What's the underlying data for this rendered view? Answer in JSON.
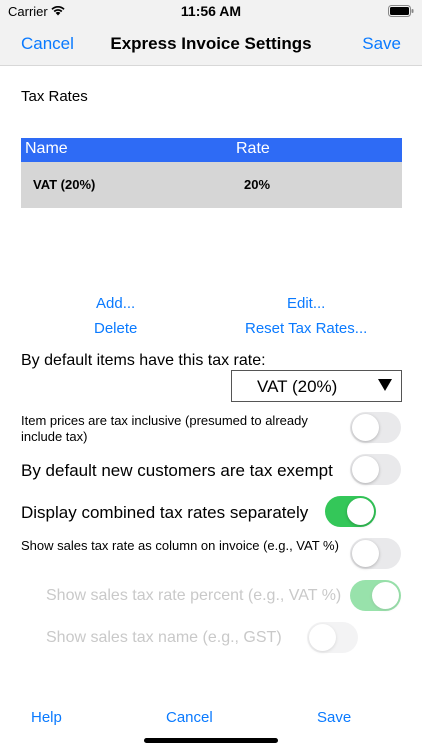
{
  "status_bar": {
    "carrier": "Carrier",
    "time": "11:56 AM",
    "wifi_icon": "wifi-icon",
    "battery_icon": "battery-icon"
  },
  "nav_bar": {
    "cancel_label": "Cancel",
    "title": "Express Invoice Settings",
    "save_label": "Save"
  },
  "tax_rates": {
    "section_title": "Tax Rates",
    "columns": [
      "Name",
      "Rate"
    ],
    "rows": [
      {
        "name": "VAT (20%)",
        "rate": "20%"
      }
    ],
    "header_color": "#2e6bf5",
    "row_color": "#d6d6d6",
    "actions": {
      "add": "Add...",
      "edit": "Edit...",
      "delete": "Delete",
      "reset": "Reset Tax Rates..."
    }
  },
  "default_rate": {
    "label": "By default items have this tax rate:",
    "selected": "VAT (20%)",
    "arrow_icon": "triangle-down-icon"
  },
  "settings": {
    "tax_inclusive": {
      "label": "Item prices are tax inclusive (presumed to already include tax)",
      "on": false
    },
    "tax_exempt": {
      "label": "By default new customers are tax exempt",
      "on": false
    },
    "combined_separately": {
      "label": "Display combined tax rates separately",
      "on": true
    },
    "rate_as_column": {
      "label": "Show sales tax rate as column on invoice  (e.g., VAT %)",
      "on": false
    },
    "rate_percent": {
      "label": "Show sales tax rate percent (e.g., VAT %)",
      "on": true,
      "enabled": false
    },
    "tax_name": {
      "label": "Show sales tax name (e.g., GST)",
      "on": false,
      "enabled": false
    }
  },
  "toggle_on_color": "#34c759",
  "accent_color": "#0a7aff",
  "bottom_bar": {
    "help_label": "Help",
    "cancel_label": "Cancel",
    "save_label": "Save"
  }
}
